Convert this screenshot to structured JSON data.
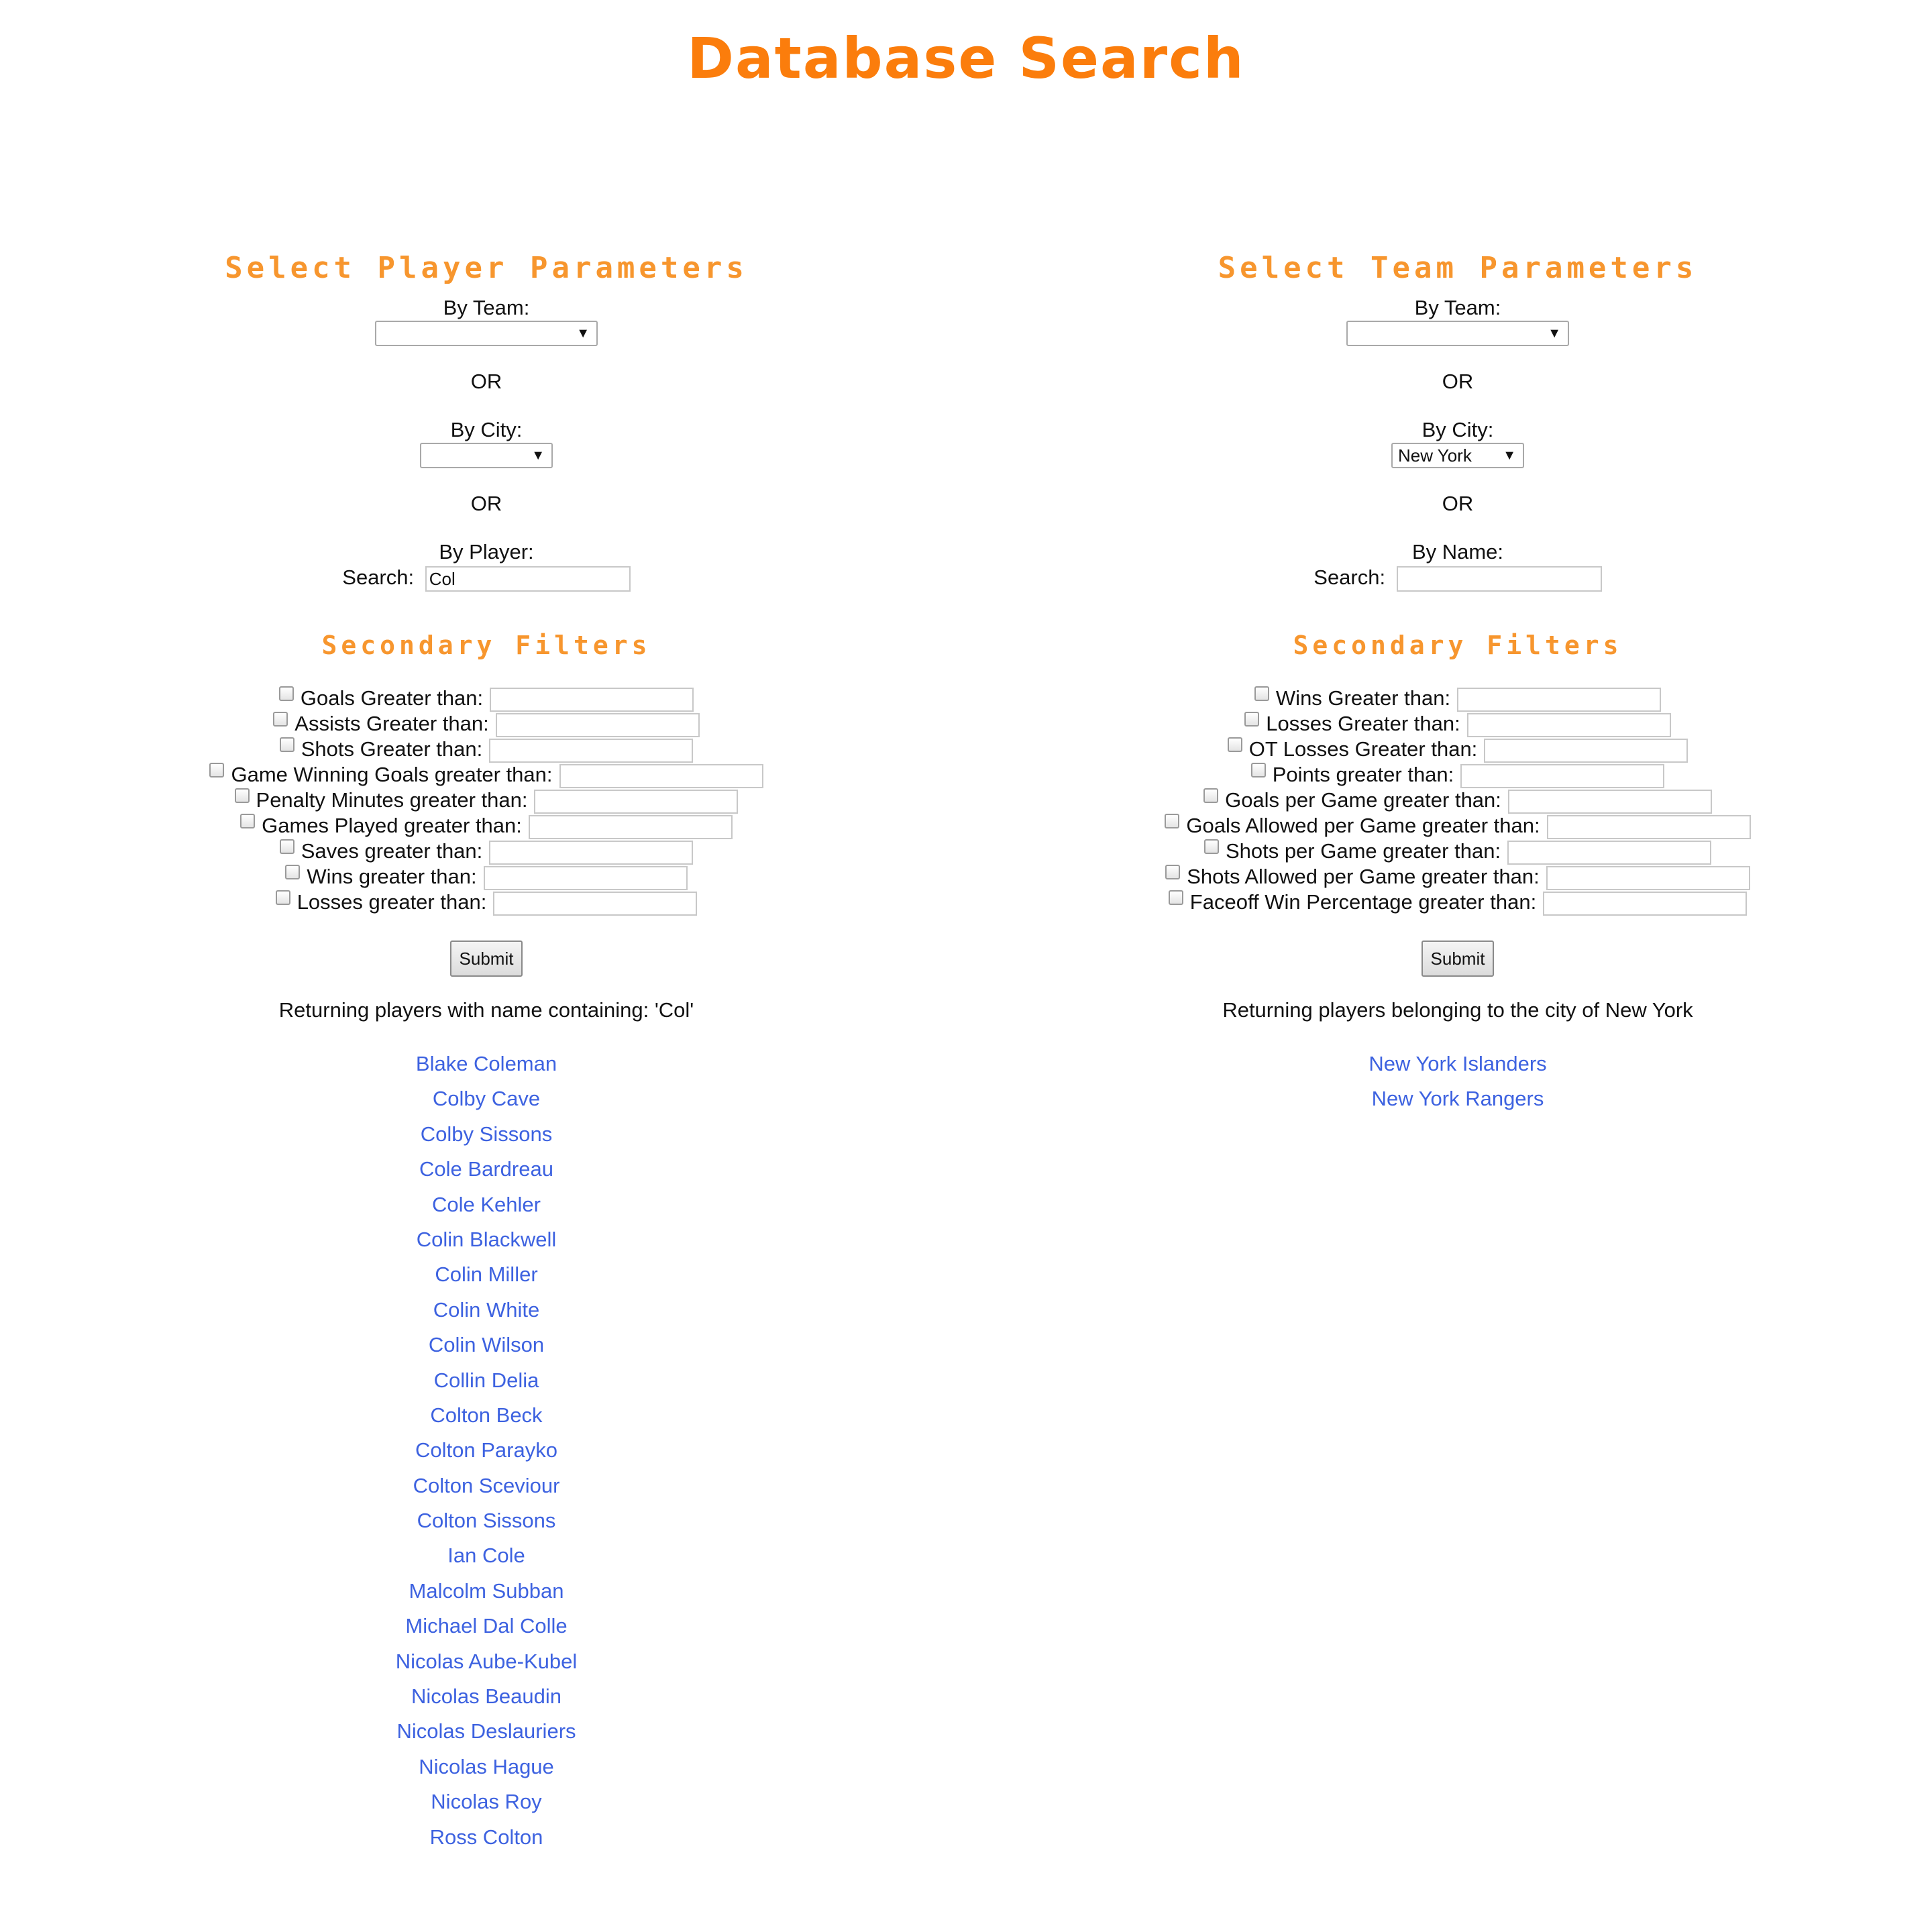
{
  "page": {
    "title": "Database Search"
  },
  "player": {
    "title": "Select Player Parameters",
    "by_team_label": "By Team:",
    "team_value": "",
    "or1": "OR",
    "by_city_label": "By City:",
    "city_value": "",
    "or2": "OR",
    "by_player_label": "By Player:",
    "search_label": "Search:",
    "search_value": "Col",
    "secondary_title": "Secondary Filters",
    "filters": [
      "Goals Greater than:",
      "Assists Greater than:",
      "Shots Greater than:",
      "Game Winning Goals greater than:",
      "Penalty Minutes greater than:",
      "Games Played greater than:",
      "Saves greater than:",
      "Wins greater than:",
      "Losses greater than:"
    ],
    "submit_label": "Submit",
    "result_text": "Returning players with name containing: 'Col'",
    "results": [
      "Blake Coleman",
      "Colby Cave",
      "Colby Sissons",
      "Cole Bardreau",
      "Cole Kehler",
      "Colin Blackwell",
      "Colin Miller",
      "Colin White",
      "Colin Wilson",
      "Collin Delia",
      "Colton Beck",
      "Colton Parayko",
      "Colton Sceviour",
      "Colton Sissons",
      "Ian Cole",
      "Malcolm Subban",
      "Michael Dal Colle",
      "Nicolas Aube-Kubel",
      "Nicolas Beaudin",
      "Nicolas Deslauriers",
      "Nicolas Hague",
      "Nicolas Roy",
      "Ross Colton"
    ]
  },
  "team": {
    "title": "Select Team Parameters",
    "by_team_label": "By Team:",
    "team_value": "",
    "or1": "OR",
    "by_city_label": "By City:",
    "city_value": "New York",
    "or2": "OR",
    "by_name_label": "By Name:",
    "search_label": "Search:",
    "search_value": "",
    "secondary_title": "Secondary Filters",
    "filters": [
      "Wins Greater than:",
      "Losses Greater than:",
      "OT Losses Greater than:",
      "Points greater than:",
      "Goals per Game greater than:",
      "Goals Allowed per Game greater than:",
      "Shots per Game greater than:",
      "Shots Allowed per Game greater than:",
      "Faceoff Win Percentage greater than:"
    ],
    "submit_label": "Submit",
    "result_text": "Returning players belonging to the city of New York",
    "results": [
      "New York Islanders",
      "New York Rangers"
    ]
  },
  "icons": {
    "dropdown_arrow": "▼"
  },
  "colors": {
    "title": "#fb7d0c",
    "section": "#f7962e",
    "link": "#3d62e0"
  }
}
